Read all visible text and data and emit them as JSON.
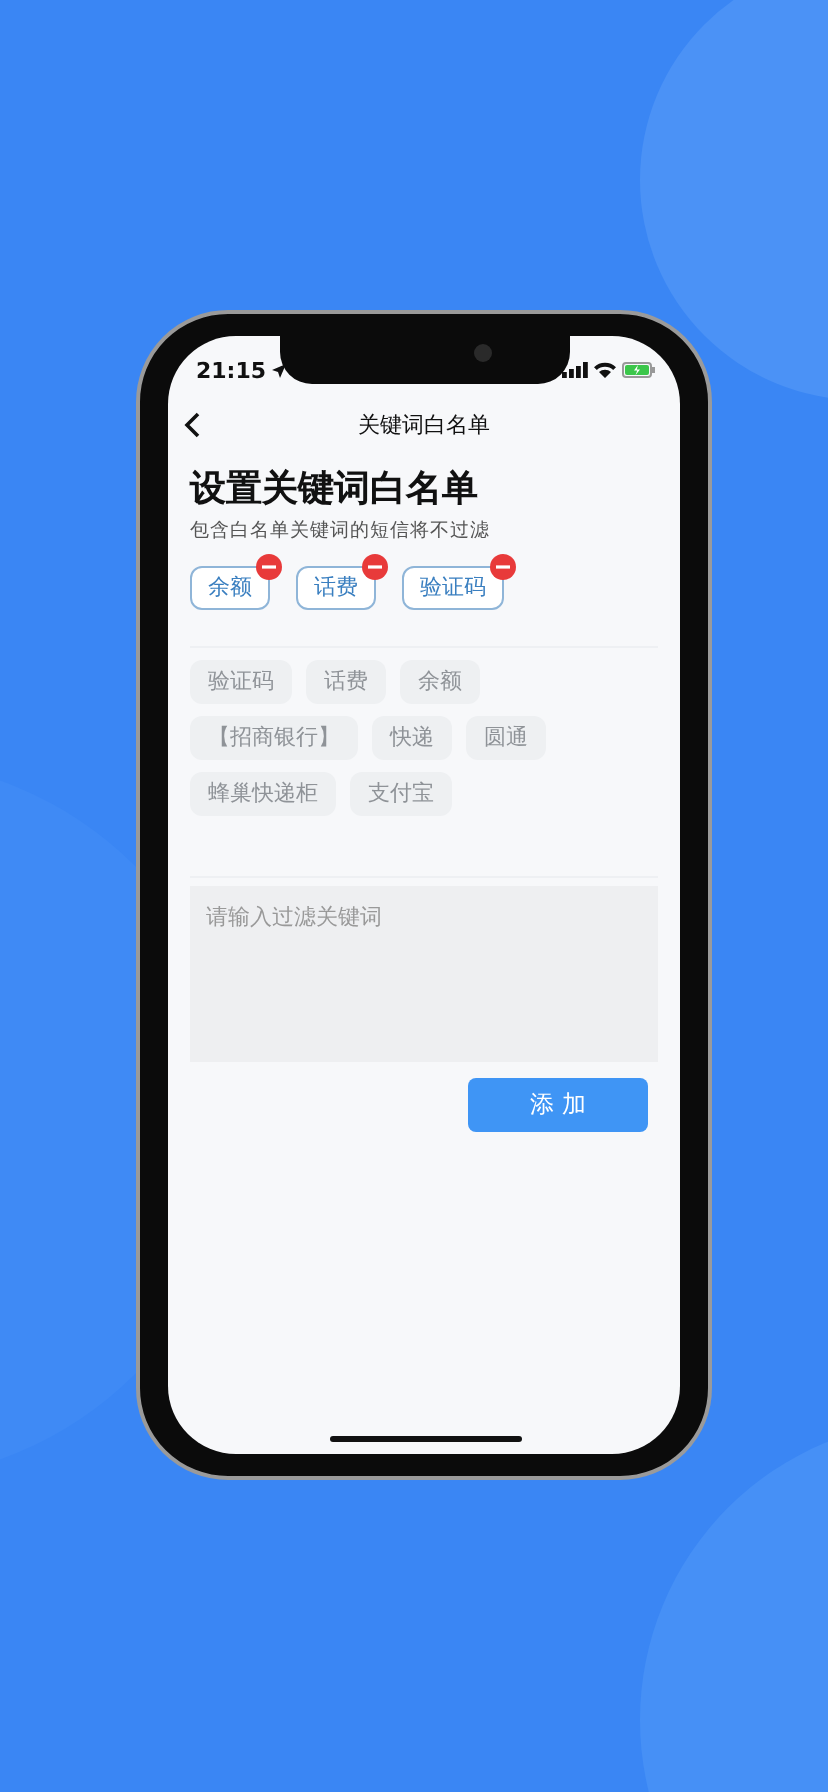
{
  "status_bar": {
    "time": "21:15"
  },
  "nav": {
    "title": "关键词白名单"
  },
  "heading": "设置关键词白名单",
  "subtitle": "包含白名单关键词的短信将不过滤",
  "keywords": [
    "余额",
    "话费",
    "验证码"
  ],
  "suggestions": [
    [
      "验证码",
      "话费",
      "余额"
    ],
    [
      "【招商银行】",
      "快递",
      "圆通"
    ],
    [
      "蜂巢快递柜",
      "支付宝"
    ]
  ],
  "input": {
    "placeholder": "请输入过滤关键词"
  },
  "add_button": "添 加"
}
